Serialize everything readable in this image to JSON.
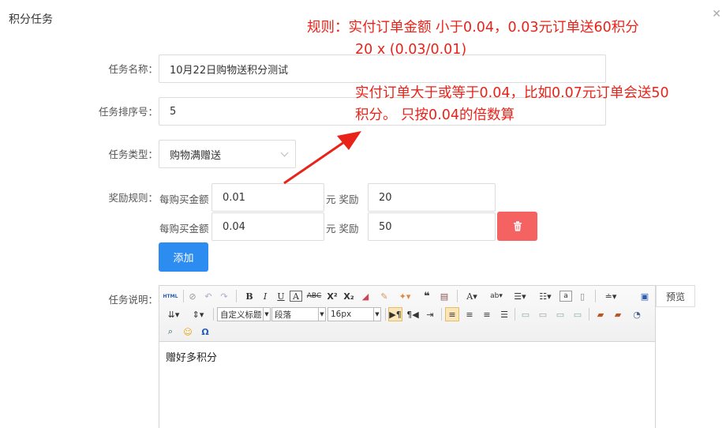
{
  "dialog": {
    "title": "积分任务",
    "close_icon": "close-icon"
  },
  "form": {
    "task_name_label": "任务名称：",
    "task_name_value": "10月22日购物送积分测试",
    "sort_label": "任务排序号：",
    "sort_value": "5",
    "type_label": "任务类型：",
    "type_value": "购物满赠送",
    "reward_label": "奖励规则：",
    "rules": [
      {
        "prefix": "每购买金额",
        "amount": "0.01",
        "unit": "元 奖励",
        "points": "20"
      },
      {
        "prefix": "每购买金额",
        "amount": "0.04",
        "unit": "元 奖励",
        "points": "50"
      }
    ],
    "add_button": "添加",
    "desc_label": "任务说明："
  },
  "annotation": {
    "line1": "规则：实付订单金额  小于0.04，0.03元订单送60积分",
    "line2": "20 x (0.03/0.01)",
    "line3": "实付订单大于或等于0.04，比如0.07元订单会送50",
    "line4": "积分。    只按0.04的倍数算",
    "color": "#e8231a"
  },
  "editor": {
    "heading_dropdown": "自定义标题",
    "paragraph_dropdown": "段落",
    "fontsize_dropdown": "16px",
    "content": "赠好多积分",
    "preview_button": "预览"
  },
  "colors": {
    "primary": "#2d8cf0",
    "danger": "#f56262",
    "annotation": "#e8231a"
  }
}
